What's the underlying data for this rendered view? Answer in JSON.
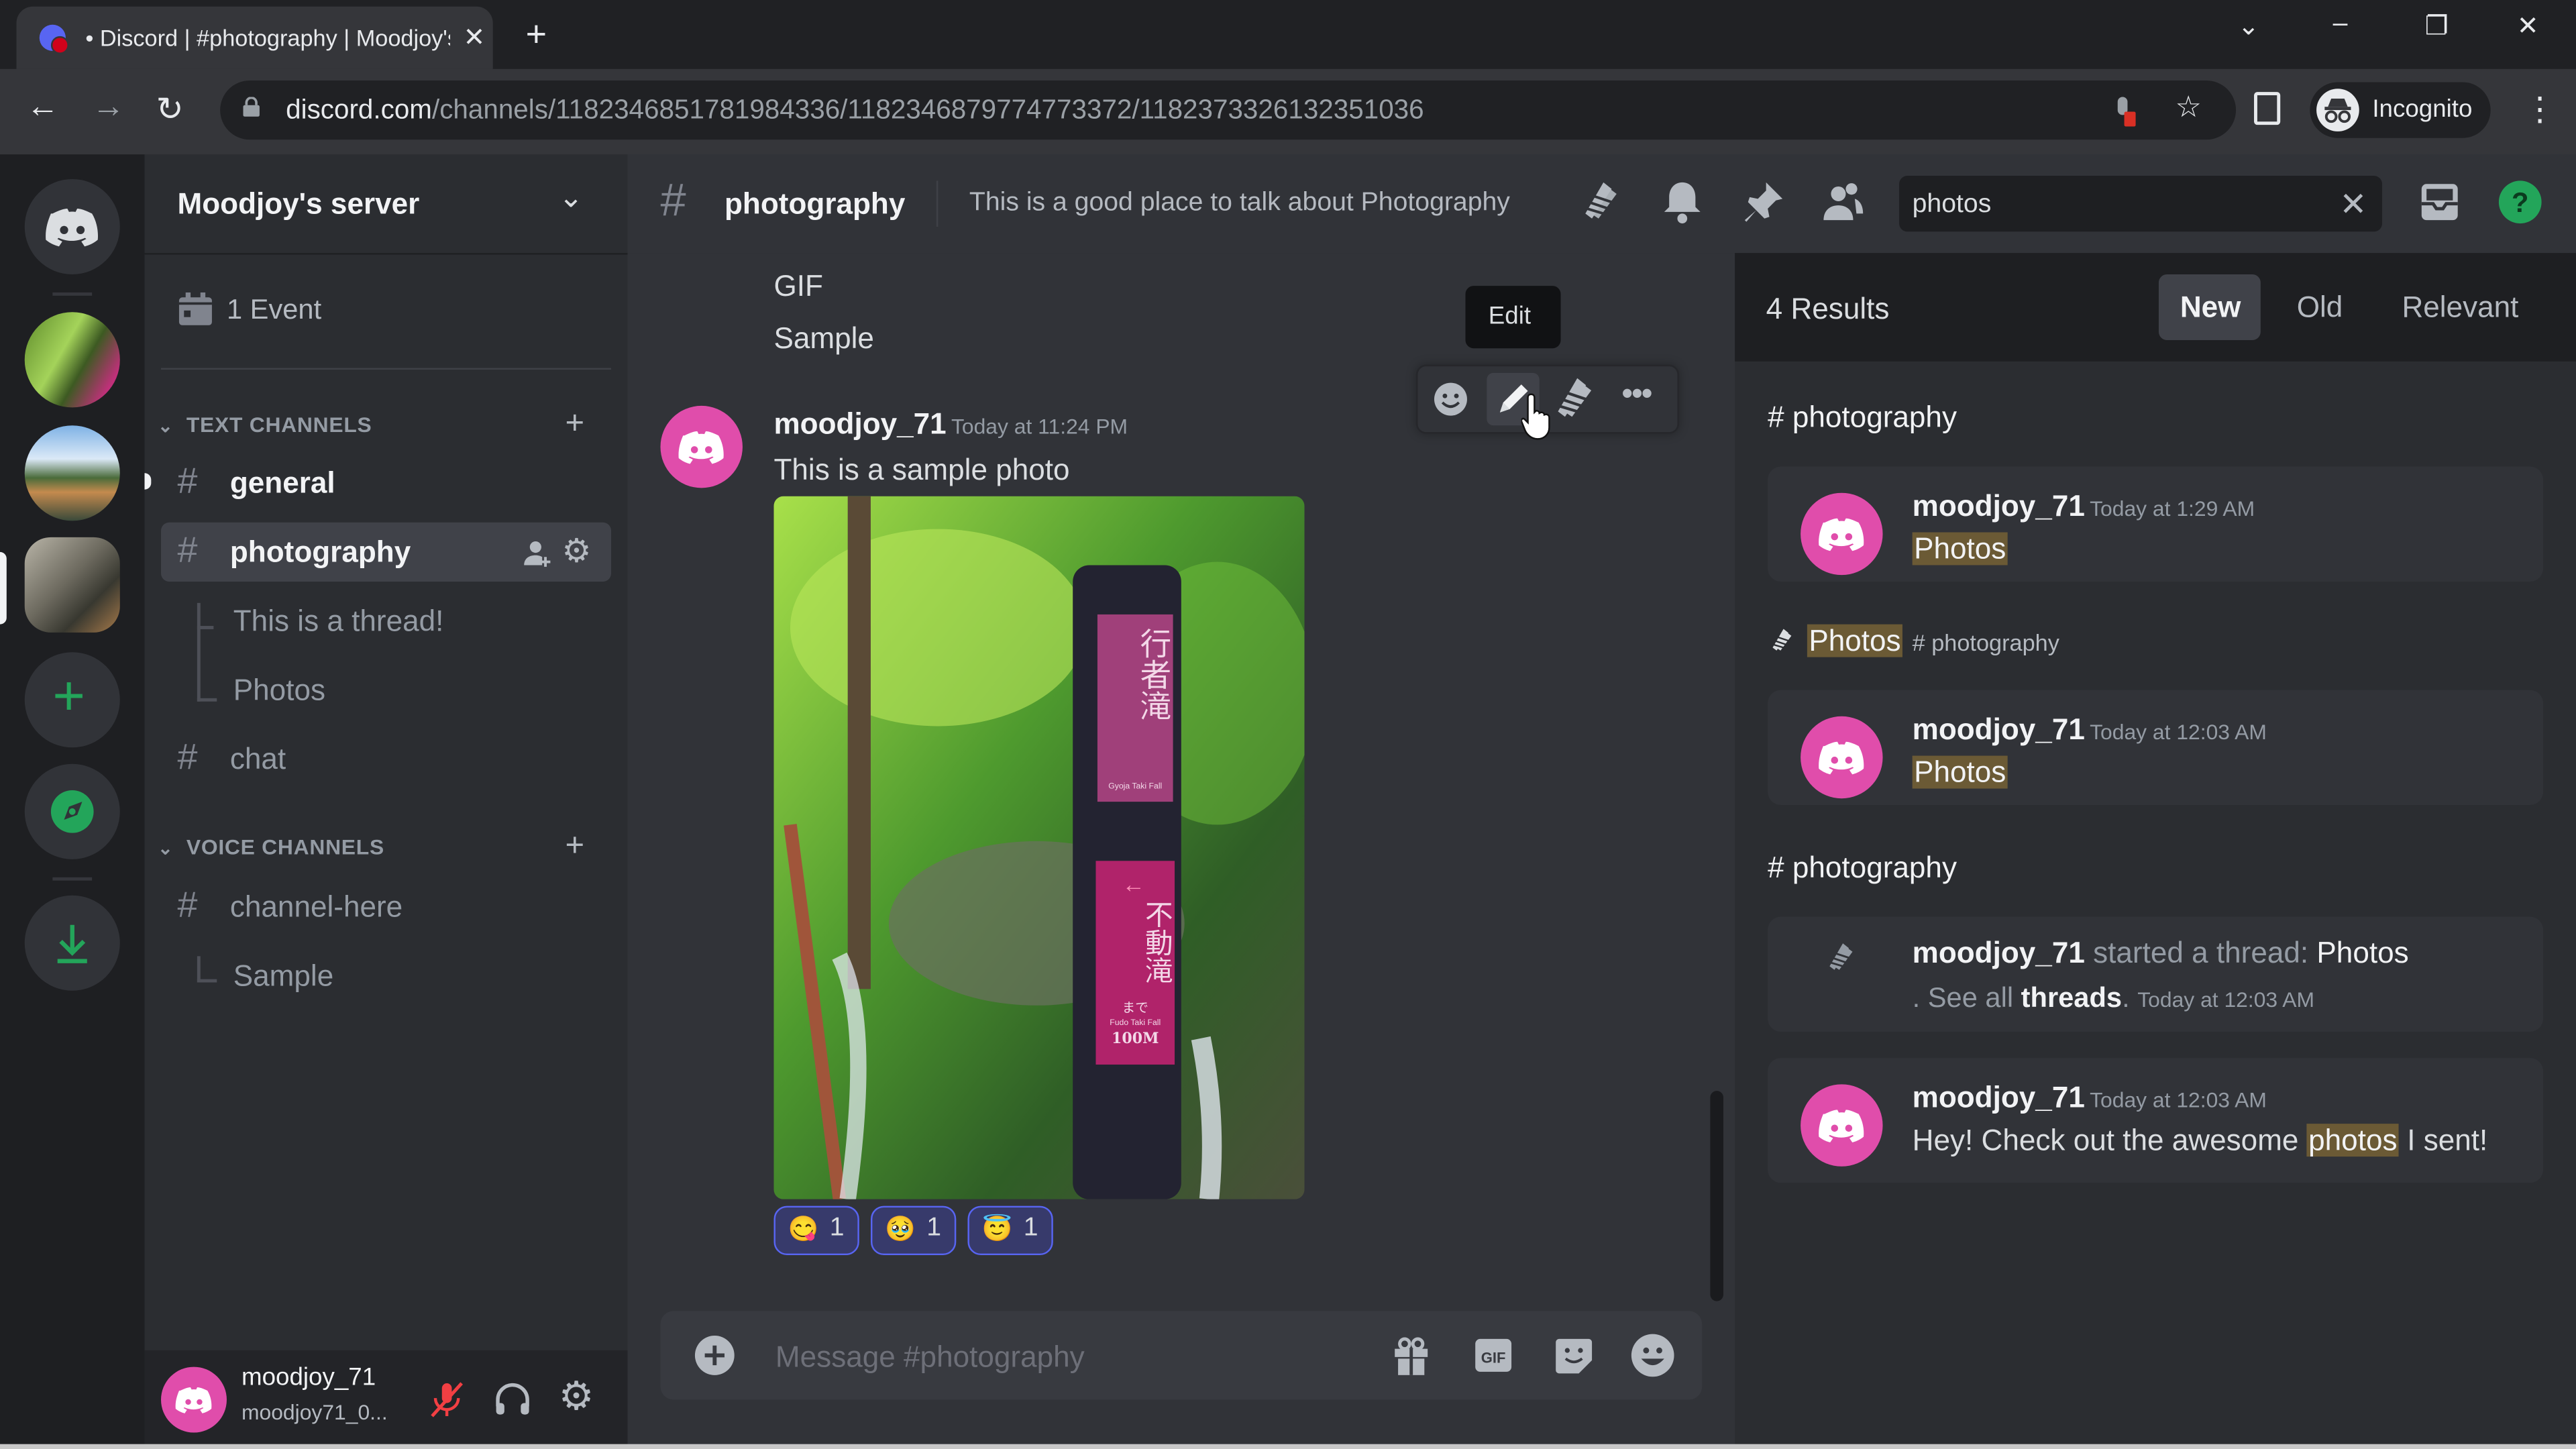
{
  "browser": {
    "tab_title": "• Discord | #photography | Moodjoy's server",
    "url_domain": "discord.com",
    "url_path": "/channels/1182346851781984336/1182346879774773372/1182373326132351036",
    "profile_label": "Incognito"
  },
  "server": {
    "name": "Moodjoy's server",
    "events_label": "1 Event",
    "guild_icons": [
      "discord-home",
      "server-waterfall",
      "server-temple",
      "server-bridge",
      "add-server",
      "explore",
      "download-apps"
    ]
  },
  "categories": {
    "text": {
      "label": "TEXT CHANNELS",
      "channels": [
        {
          "name": "general",
          "state": "unread"
        },
        {
          "name": "photography",
          "state": "selected"
        }
      ],
      "threads": [
        "This is a thread!",
        "Photos"
      ],
      "after": [
        {
          "name": "chat"
        }
      ]
    },
    "voice": {
      "label": "VOICE CHANNELS",
      "channels": [
        {
          "name": "channel-here"
        }
      ],
      "threads": [
        "Sample"
      ]
    }
  },
  "user": {
    "name": "moodjoy_71",
    "tag": "moodjoy71_0..."
  },
  "channel": {
    "name": "photography",
    "topic": "This is a good place to talk about Photography"
  },
  "search": {
    "query": "photos"
  },
  "messages": {
    "prev_lines": [
      "GIF",
      "Sample"
    ],
    "main": {
      "author": "moodjoy_71",
      "timestamp": "Today at 11:24 PM",
      "text": "This is a sample photo",
      "image_sign": {
        "top_kanji": "行者滝",
        "top_en": "Gyoja Taki Fall",
        "bottom_kanji": "不動滝",
        "bottom_sub": "まで",
        "bottom_en": "Fudo Taki Fall",
        "distance": "100M"
      },
      "reactions": [
        {
          "emoji": "😋",
          "count": "1"
        },
        {
          "emoji": "🥹",
          "count": "1"
        },
        {
          "emoji": "😇",
          "count": "1"
        }
      ]
    },
    "tooltip": "Edit"
  },
  "composer": {
    "placeholder": "Message #photography"
  },
  "results": {
    "count_label": "4 Results",
    "sort_tabs": [
      "New",
      "Old",
      "Relevant"
    ],
    "active_sort": "New",
    "groups": [
      {
        "header": "# photography",
        "author": "moodjoy_71",
        "timestamp": "Today at 1:29 AM",
        "text": "Photos"
      },
      {
        "thread_name": "Photos",
        "parent": "# photography",
        "author": "moodjoy_71",
        "timestamp": "Today at 12:03 AM",
        "text": "Photos"
      },
      {
        "header": "# photography",
        "system": {
          "author": "moodjoy_71",
          "action": " started a thread: ",
          "thread": "Photos",
          "see_all_prefix": ". See all ",
          "see_all_link": "threads",
          "suffix": ".",
          "timestamp": "Today at 12:03 AM"
        },
        "message": {
          "author": "moodjoy_71",
          "timestamp": "Today at 12:03 AM",
          "text_before": "Hey! Check out the awesome ",
          "highlight": "photos",
          "text_after": " I sent!"
        }
      }
    ]
  },
  "colors": {
    "brand": "#5865f2",
    "avatar": "#e04dab",
    "green": "#23a55a",
    "highlight": "#6b5a35"
  }
}
